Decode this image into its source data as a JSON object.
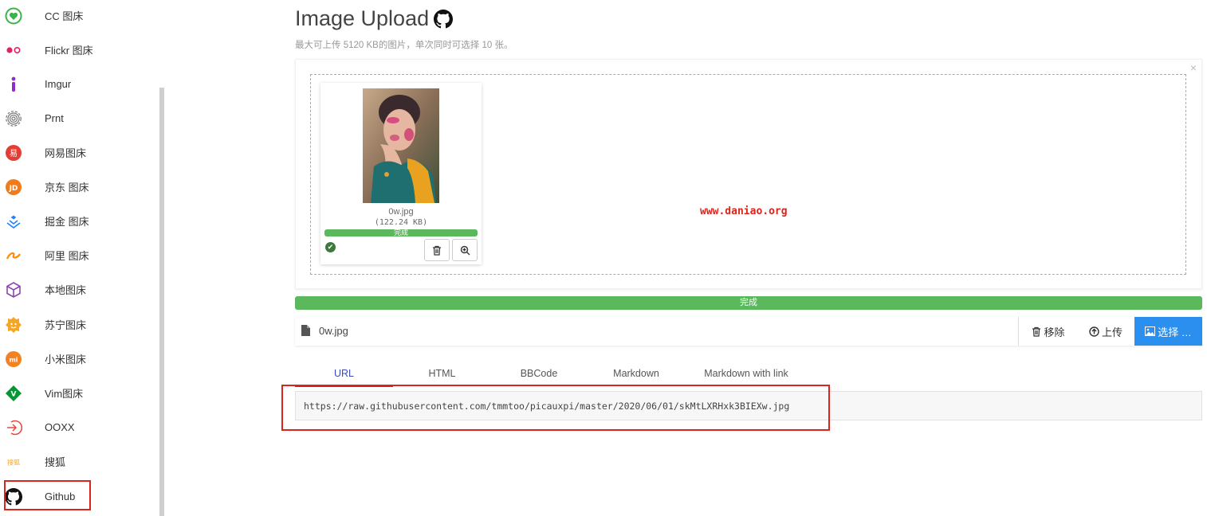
{
  "sidebar": {
    "items": [
      {
        "label": "CC 图床",
        "icon": "heart-circle-icon"
      },
      {
        "label": "Flickr 图床",
        "icon": "flickr-icon"
      },
      {
        "label": "Imgur",
        "icon": "imgur-icon"
      },
      {
        "label": "Prnt",
        "icon": "fingerprint-icon"
      },
      {
        "label": "网易图床",
        "icon": "netease-icon"
      },
      {
        "label": "京东 图床",
        "icon": "jd-icon"
      },
      {
        "label": "掘金 图床",
        "icon": "juejin-icon"
      },
      {
        "label": "阿里 图床",
        "icon": "alibaba-icon"
      },
      {
        "label": "本地图床",
        "icon": "cube-icon"
      },
      {
        "label": "苏宁图床",
        "icon": "suning-icon"
      },
      {
        "label": "小米图床",
        "icon": "xiaomi-icon"
      },
      {
        "label": "Vim图床",
        "icon": "vim-icon"
      },
      {
        "label": "OOXX",
        "icon": "sign-in-icon"
      },
      {
        "label": "搜狐",
        "icon": "sohu-icon"
      },
      {
        "label": "Github",
        "icon": "github-icon"
      }
    ]
  },
  "header": {
    "title": "Image Upload",
    "subtitle": "最大可上传 5120 KB的图片，单次同时可选择 10 张。"
  },
  "dropzone": {
    "close": "×",
    "preview": {
      "file_name": "0w.jpg",
      "file_size": "(122.24 KB)",
      "status": "完成"
    },
    "watermark": "www.daniao.org"
  },
  "progress": {
    "label": "完成",
    "percent": 100
  },
  "file_row": {
    "file_name": "0w.jpg",
    "remove_label": "移除",
    "upload_label": "上传",
    "choose_label": "选择 …"
  },
  "tabs": [
    {
      "label": "URL",
      "active": true
    },
    {
      "label": "HTML",
      "active": false
    },
    {
      "label": "BBCode",
      "active": false
    },
    {
      "label": "Markdown",
      "active": false
    },
    {
      "label": "Markdown with link",
      "active": false
    }
  ],
  "result": {
    "url": "https://raw.githubusercontent.com/tmmtoo/picauxpi/master/2020/06/01/skMtLXRHxk3BIEXw.jpg"
  },
  "colors": {
    "accent": "#2b8ff0",
    "success": "#5cb85c",
    "highlight": "#d9251d",
    "tab_active": "#3a4cb5"
  }
}
